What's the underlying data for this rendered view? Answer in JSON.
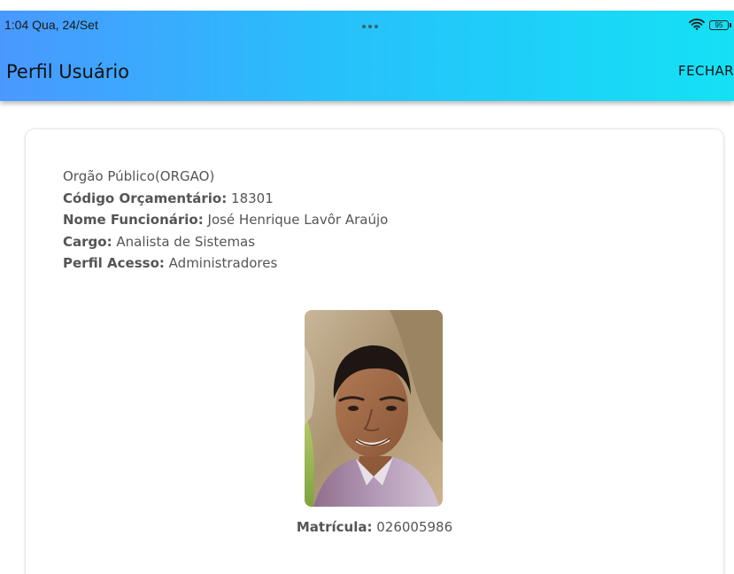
{
  "status_bar": {
    "time_date": "1:04  Qua, 24/Set",
    "battery_level": "95",
    "icons": [
      "wifi-icon",
      "battery-icon"
    ]
  },
  "app_bar": {
    "title": "Perfil Usuário",
    "close_label": "FECHAR",
    "gradient_colors": [
      "#4a98ff",
      "#14e1f5"
    ]
  },
  "profile": {
    "org": "Orgão Público(ORGAO)",
    "codigo_label": "Código Orçamentário:",
    "codigo_value": "18301",
    "nome_label": "Nome Funcionário:",
    "nome_value": "José Henrique Lavôr Araújo",
    "cargo_label": "Cargo:",
    "cargo_value": "Analista de Sistemas",
    "perfil_label": "Perfil Acesso:",
    "perfil_value": "Administradores",
    "matricula_label": "Matrícula:",
    "matricula_value": "026005986",
    "photo": "user-photo"
  }
}
